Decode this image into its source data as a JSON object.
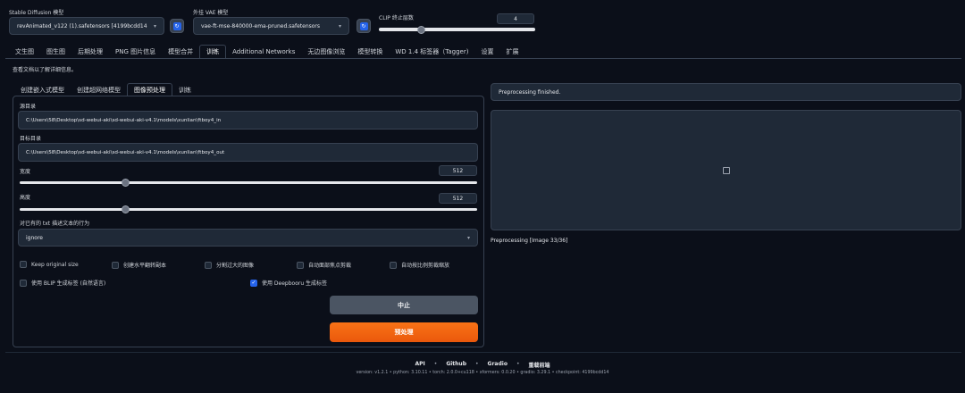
{
  "top": {
    "sd_model_label": "Stable Diffusion 模型",
    "sd_model_value": "revAnimated_v122 (1).safetensors [4199bcdd14",
    "vae_label": "外挂 VAE 模型",
    "vae_value": "vae-ft-mse-840000-ema-pruned.safetensors",
    "clip_label": "CLIP 终止层数",
    "clip_value": "4",
    "clip_fraction": 0.27
  },
  "main_tabs": [
    "文生图",
    "图生图",
    "后期处理",
    "PNG 图片信息",
    "模型合并",
    "训练",
    "Additional Networks",
    "无边图像浏览",
    "模型转换",
    "WD 1.4 标签器（Tagger)",
    "设置",
    "扩展"
  ],
  "main_tab_active": 5,
  "hint": "查看文档以了解详细信息。",
  "sub_tabs": [
    "创建嵌入式模型",
    "创建超网络模型",
    "图像预处理",
    "训练"
  ],
  "sub_tab_active": 2,
  "form": {
    "src_label": "源目录",
    "src_value": "C:\\Users\\58\\Desktop\\sd-webui-aki\\sd-webui-aki-v4.1\\models\\xunlian\\ftboy4_in",
    "dst_label": "目标目录",
    "dst_value": "C:\\Users\\58\\Desktop\\sd-webui-aki\\sd-webui-aki-v4.1\\models\\xunlian\\ftboy4_out",
    "width_label": "宽度",
    "width_value": "512",
    "width_fraction": 0.23,
    "height_label": "高度",
    "height_value": "512",
    "height_fraction": 0.23,
    "existing_txt_label": "对已有的 txt 描述文本的行为",
    "existing_txt_value": "ignore",
    "checkboxes": [
      {
        "label": "Keep original size",
        "checked": false
      },
      {
        "label": "创建水平翻转副本",
        "checked": false
      },
      {
        "label": "分割过大的图像",
        "checked": false
      },
      {
        "label": "自动面部焦点剪裁",
        "checked": false
      },
      {
        "label": "自动按比例剪裁缩放",
        "checked": false
      },
      {
        "label": "使用 BLIP 生成标签 (自然语言)",
        "checked": false
      },
      {
        "label": "使用 Deepbooru 生成标签",
        "checked": true
      }
    ],
    "interrupt_label": "中止",
    "preprocess_label": "预处理"
  },
  "right": {
    "status": "Preprocessing finished.",
    "image_icon": "image-placeholder-icon",
    "progress_text": "Preprocessing [Image 33/36]"
  },
  "footer": {
    "links": [
      "API",
      "Github",
      "Gradio",
      "重载前端"
    ],
    "version": "version: v1.2.1  •  python: 3.10.11  •  torch: 2.0.0+cu118  •  xformers: 0.0.20  •  gradio: 3.29.1  •  checkpoint: 4199bcdd14"
  }
}
